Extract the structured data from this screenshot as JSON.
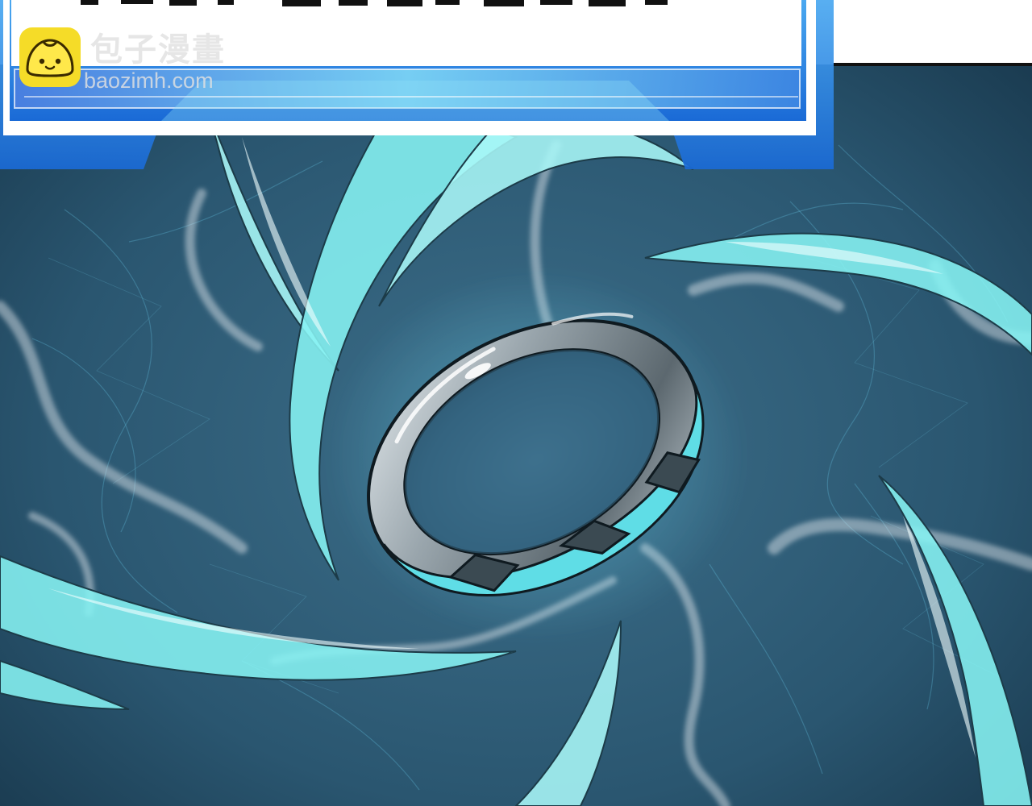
{
  "watermark": {
    "site_name": "包子漫畫",
    "domain": "baozimh.com",
    "logo_icon": "bun-mascot-icon",
    "logo_color": "#f5dc28"
  },
  "panel": {
    "background_color": "#2a5670",
    "energy_color": "#86f2f2",
    "frame_color": "#2d7ddc",
    "ring_icon": "glowing-ring-icon"
  }
}
